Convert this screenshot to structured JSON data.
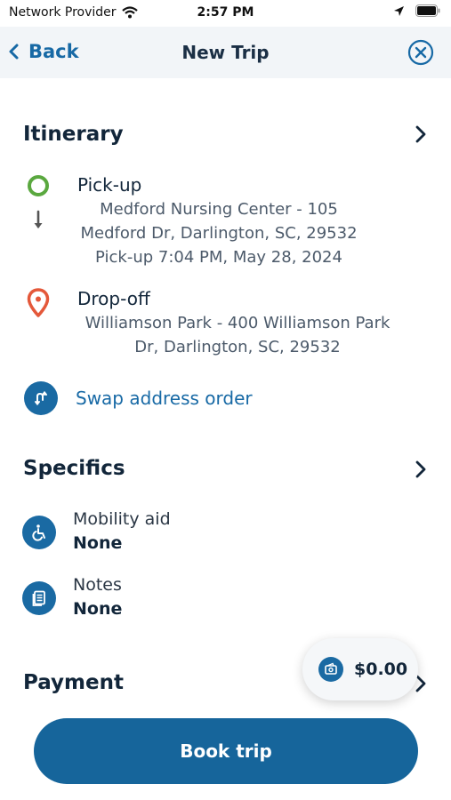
{
  "status_bar": {
    "carrier": "Network Provider",
    "time": "2:57 PM"
  },
  "nav": {
    "back_label": "Back",
    "title": "New Trip"
  },
  "itinerary": {
    "title": "Itinerary",
    "pickup": {
      "label": "Pick-up",
      "line1": "Medford Nursing Center - 105",
      "line2": "Medford Dr, Darlington, SC, 29532",
      "line3": "Pick-up 7:04 PM, May 28, 2024"
    },
    "dropoff": {
      "label": "Drop-off",
      "line1": "Williamson Park - 400 Williamson Park",
      "line2": "Dr, Darlington, SC, 29532"
    },
    "swap_label": "Swap address order"
  },
  "specifics": {
    "title": "Specifics",
    "mobility_label": "Mobility aid",
    "mobility_value": "None",
    "notes_label": "Notes",
    "notes_value": "None"
  },
  "payment": {
    "title": "Payment",
    "price": "$0.00"
  },
  "book_label": "Book trip",
  "colors": {
    "accent": "#1a6aa3",
    "pickup_ring": "#5aa83f",
    "dropoff_pin": "#e4583a"
  }
}
